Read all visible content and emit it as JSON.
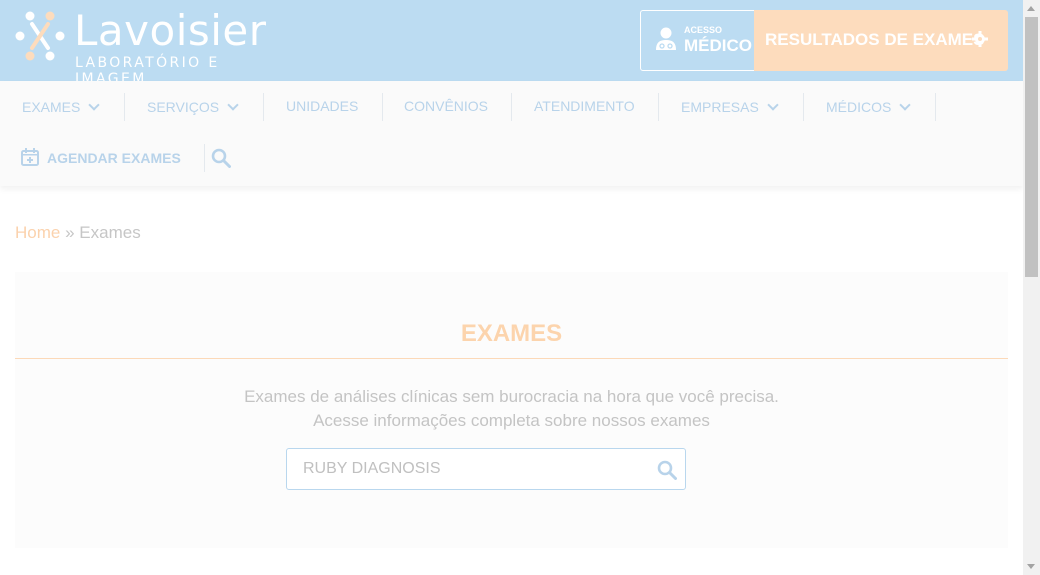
{
  "header": {
    "logo": {
      "name": "Lavoisier",
      "tagline": "LABORATÓRIO E IMAGEM"
    },
    "medico_button": {
      "small": "ACESSO",
      "big": "MÉDICO"
    },
    "resultados_button": {
      "label": "RESULTADOS DE EXAMES"
    }
  },
  "nav": {
    "items": [
      {
        "label": "EXAMES",
        "dropdown": true
      },
      {
        "label": "SERVIÇOS",
        "dropdown": true
      },
      {
        "label": "UNIDADES",
        "dropdown": false
      },
      {
        "label": "CONVÊNIOS",
        "dropdown": false
      },
      {
        "label": "ATENDIMENTO",
        "dropdown": false
      },
      {
        "label": "EMPRESAS",
        "dropdown": true
      },
      {
        "label": "MÉDICOS",
        "dropdown": true
      }
    ],
    "agendar": "AGENDAR EXAMES"
  },
  "breadcrumb": {
    "home": "Home",
    "sep": "»",
    "current": "Exames"
  },
  "card": {
    "title": "EXAMES",
    "desc_line1": "Exames de análises clínicas sem burocracia na hora que você precisa.",
    "desc_line2": "Acesse informações completa sobre nossos exames",
    "search_placeholder": "RUBY DIAGNOSIS"
  },
  "colors": {
    "header_bg": "#bcdcf2",
    "accent_orange": "#fddcbd",
    "nav_text": "#b8d3ea"
  }
}
